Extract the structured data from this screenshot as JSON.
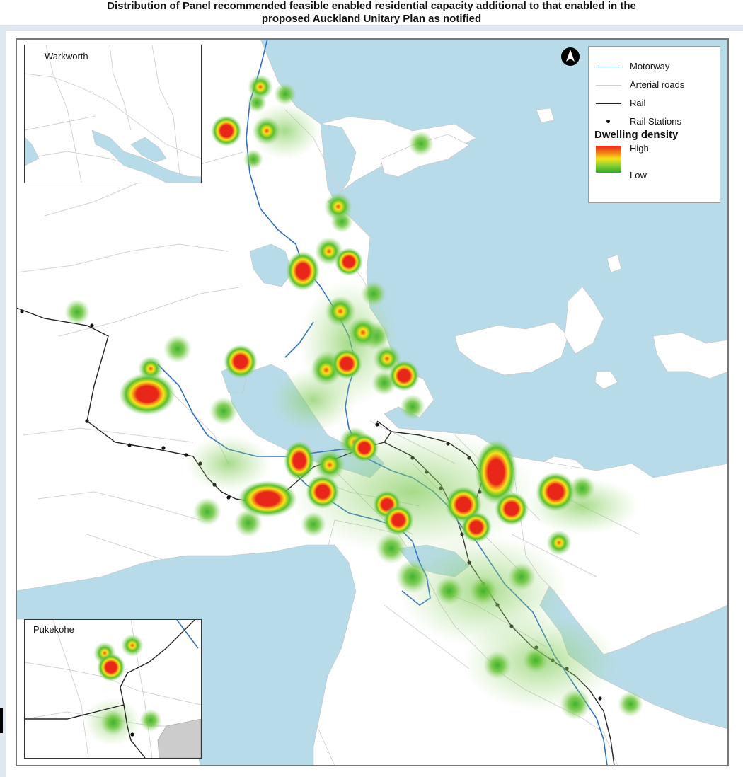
{
  "title": {
    "line1": "Distribution of Panel recommended feasible enabled residential capacity additional to that enabled in the",
    "line2": "proposed Auckland Unitary Plan as notified"
  },
  "insets": {
    "north": {
      "label": "Warkworth"
    },
    "south": {
      "label": "Pukekohe"
    }
  },
  "legend": {
    "motorway": "Motorway",
    "arterial": "Arterial roads",
    "rail": "Rail",
    "stations": "Rail Stations",
    "density_title": "Dwelling density",
    "high": "High",
    "low": "Low"
  },
  "colors": {
    "water": "#b7dbe9",
    "land": "#ffffff",
    "motorway": "#2f6fc4",
    "arterial": "#d3d3d3",
    "rail": "#222222",
    "high": "#e8261a",
    "mid": "#f7e31a",
    "low": "#2faa26"
  },
  "icons": {
    "north_arrow": "north-arrow-icon"
  }
}
